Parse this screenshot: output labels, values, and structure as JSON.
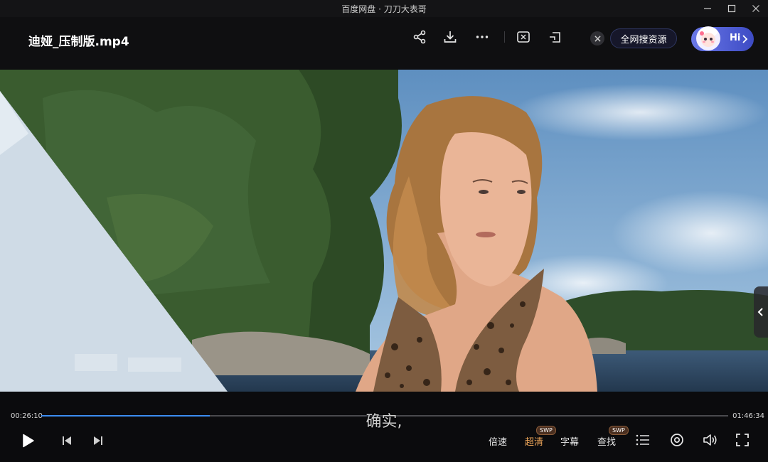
{
  "window": {
    "title": "百度网盘 · 刀刀大表哥"
  },
  "header": {
    "filename": "迪娅_压制版.mp4",
    "search_all_label": "全网搜资源",
    "assistant_label": "Hi",
    "icons": [
      "share-icon",
      "download-icon",
      "more-icon",
      "cast-icon",
      "pip-icon"
    ]
  },
  "player": {
    "current_time": "00:26:10",
    "total_time": "01:46:34",
    "progress": 0.245,
    "subtitle": "确实,",
    "speed_label": "倍速",
    "quality_label": "超清",
    "quality_badge": "SWP",
    "subtitles_label": "字幕",
    "find_label": "查找",
    "find_badge": "SWP",
    "accent_color": "#3b8cf0",
    "active_color": "#f2a85a"
  }
}
